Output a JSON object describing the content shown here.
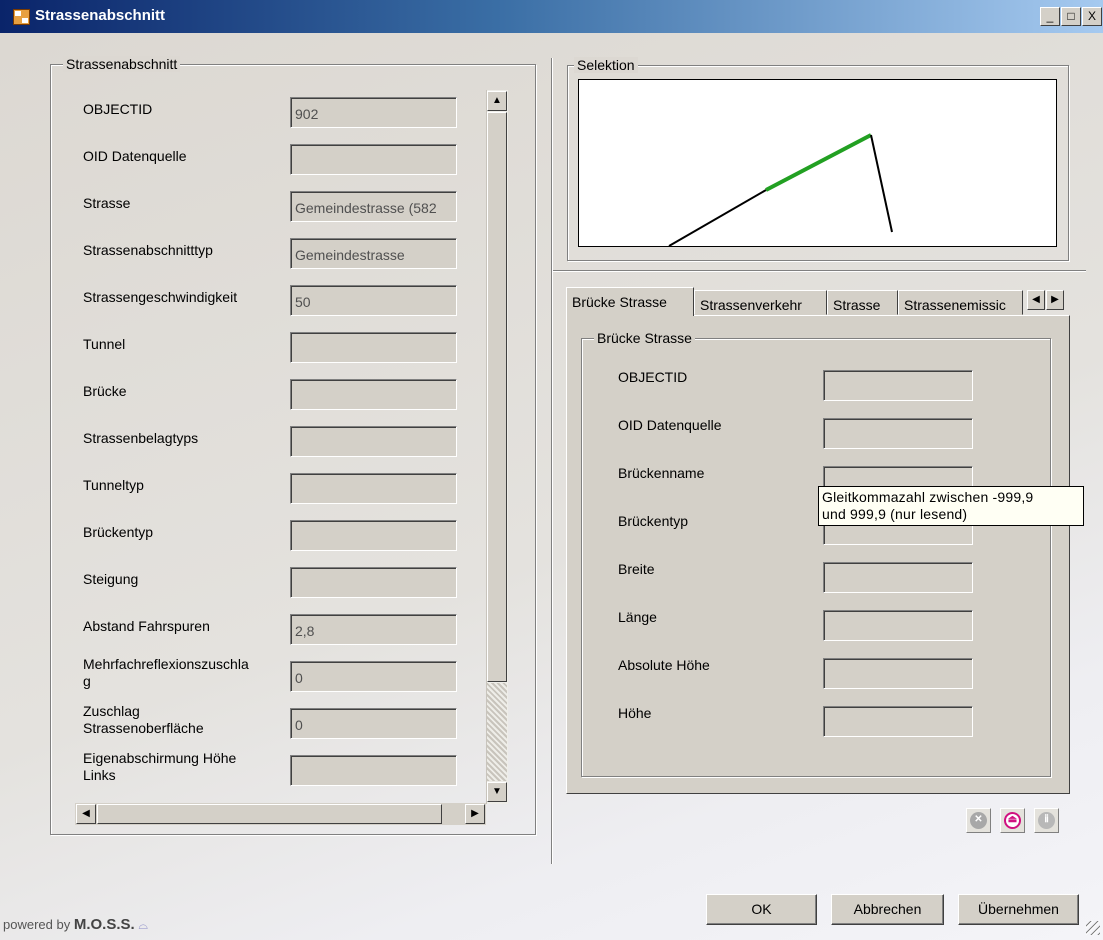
{
  "window": {
    "title": "Strassenabschnitt",
    "controls": {
      "minimize": "_",
      "maximize": "□",
      "close": "X"
    }
  },
  "left_group": {
    "legend": "Strassenabschnitt",
    "rows": [
      {
        "label": "OBJECTID",
        "value": "902"
      },
      {
        "label": "OID Datenquelle",
        "value": ""
      },
      {
        "label": "Strasse",
        "value": "Gemeindestrasse (582"
      },
      {
        "label": "Strassenabschnitttyp",
        "value": "Gemeindestrasse"
      },
      {
        "label": "Strassengeschwindigkeit",
        "value": "50"
      },
      {
        "label": "Tunnel",
        "value": ""
      },
      {
        "label": "Brücke",
        "value": ""
      },
      {
        "label": "Strassenbelagtyps",
        "value": ""
      },
      {
        "label": "Tunneltyp",
        "value": ""
      },
      {
        "label": "Brückentyp",
        "value": ""
      },
      {
        "label": "Steigung",
        "value": ""
      },
      {
        "label": "Abstand Fahrspuren",
        "value": "2,8"
      },
      {
        "label": "Mehrfachreflexionszuschla\ng",
        "value": "0"
      },
      {
        "label": "Zuschlag\nStrassenoberfläche",
        "value": "0"
      },
      {
        "label": "Eigenabschirmung Höhe\nLinks",
        "value": ""
      }
    ]
  },
  "selection": {
    "legend": "Selektion"
  },
  "tabs": {
    "items": [
      "Brücke Strasse",
      "Strassenverkehr",
      "Strasse",
      "Strassenemissic"
    ],
    "active": 0,
    "group_legend": "Brücke Strasse",
    "rows": [
      {
        "label": "OBJECTID",
        "value": ""
      },
      {
        "label": "OID Datenquelle",
        "value": ""
      },
      {
        "label": "Brückenname",
        "value": ""
      },
      {
        "label": "Brückentyp",
        "value": ""
      },
      {
        "label": "Breite",
        "value": ""
      },
      {
        "label": "Länge",
        "value": ""
      },
      {
        "label": "Absolute Höhe",
        "value": ""
      },
      {
        "label": "Höhe",
        "value": ""
      }
    ],
    "tooltip": "Gleitkommazahl zwischen -999,9\nund 999,9 (nur lesend)"
  },
  "buttons": {
    "ok": "OK",
    "cancel": "Abbrechen",
    "apply": "Übernehmen"
  },
  "footer": {
    "powered_by": "powered by",
    "brand": "M.O.S.S."
  },
  "colors": {
    "selection_highlight": "#22a022",
    "title_bar": "#0a246a"
  }
}
